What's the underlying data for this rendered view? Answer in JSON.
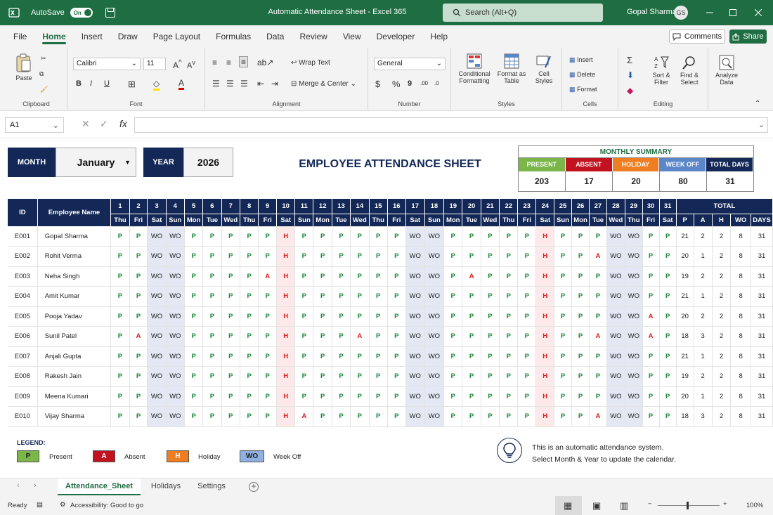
{
  "window": {
    "title": "Automatic Attendance Sheet - Excel 365",
    "autosave_label": "AutoSave",
    "autosave_state": "On",
    "search_placeholder": "Search (Alt+Q)",
    "user_name": "Gopal Sharma",
    "user_initials": "GS"
  },
  "menu": {
    "items": [
      "File",
      "Home",
      "Insert",
      "Draw",
      "Page Layout",
      "Formulas",
      "Data",
      "Review",
      "View",
      "Developer",
      "Help"
    ],
    "active": "Home",
    "comments_label": "Comments",
    "share_label": "Share"
  },
  "ribbon": {
    "clipboard": {
      "paste": "Paste",
      "label": "Clipboard"
    },
    "font": {
      "name": "Calibri",
      "size": "11",
      "label": "Font"
    },
    "alignment": {
      "wrap": "Wrap Text",
      "merge": "Merge & Center",
      "label": "Alignment"
    },
    "number": {
      "format": "General",
      "label": "Number"
    },
    "styles": {
      "cond1": "Conditional",
      "cond2": "Formatting",
      "fmt1": "Format as",
      "fmt2": "Table",
      "cell1": "Cell",
      "cell2": "Styles",
      "label": "Styles"
    },
    "cells": {
      "insert": "Insert",
      "delete": "Delete",
      "format": "Format",
      "label": "Cells"
    },
    "editing": {
      "sort1": "Sort &",
      "sort2": "Filter",
      "find1": "Find &",
      "find2": "Select",
      "label": "Editing"
    },
    "analyze": {
      "l1": "Analyze",
      "l2": "Data"
    }
  },
  "formula_bar": {
    "cell_ref": "A1",
    "fx": "fx",
    "content": ""
  },
  "sheet": {
    "month_label": "MONTH",
    "month_value": "January",
    "year_label": "YEAR",
    "year_value": "2026",
    "title": "EMPLOYEE ATTENDANCE SHEET",
    "summary": {
      "title": "MONTHLY SUMMARY",
      "items": [
        {
          "label": "PRESENT",
          "value": "203",
          "color": "#7ab648"
        },
        {
          "label": "ABSENT",
          "value": "17",
          "color": "#c1121f"
        },
        {
          "label": "HOLIDAY",
          "value": "20",
          "color": "#ef7d22"
        },
        {
          "label": "WEEK OFF",
          "value": "80",
          "color": "#5b87c9"
        },
        {
          "label": "TOTAL DAYS",
          "value": "31",
          "color": "#132856"
        }
      ]
    },
    "table": {
      "id_header": "ID",
      "name_header": "Employee Name",
      "total_header": "TOTAL",
      "days": [
        "1",
        "2",
        "3",
        "4",
        "5",
        "6",
        "7",
        "8",
        "9",
        "10",
        "11",
        "12",
        "13",
        "14",
        "15",
        "16",
        "17",
        "18",
        "19",
        "20",
        "21",
        "22",
        "23",
        "24",
        "25",
        "26",
        "27",
        "28",
        "29",
        "30",
        "31"
      ],
      "weekdays": [
        "Thu",
        "Fri",
        "Sat",
        "Sun",
        "Mon",
        "Tue",
        "Wed",
        "Thu",
        "Fri",
        "Sat",
        "Sun",
        "Mon",
        "Tue",
        "Wed",
        "Thu",
        "Fri",
        "Sat",
        "Sun",
        "Mon",
        "Tue",
        "Wed",
        "Thu",
        "Fri",
        "Sat",
        "Sun",
        "Mon",
        "Tue",
        "Wed",
        "Thu",
        "Fri",
        "Sat"
      ],
      "total_columns": [
        "P",
        "A",
        "H",
        "WO",
        "DAYS"
      ],
      "rows": [
        {
          "id": "E001",
          "name": "Gopal Sharma",
          "marks": [
            "P",
            "P",
            "WO",
            "WO",
            "P",
            "P",
            "P",
            "P",
            "P",
            "H",
            "P",
            "P",
            "P",
            "P",
            "P",
            "P",
            "WO",
            "WO",
            "P",
            "P",
            "P",
            "P",
            "P",
            "H",
            "P",
            "P",
            "P",
            "WO",
            "WO",
            "P",
            "P"
          ],
          "totals": [
            "21",
            "2",
            "2",
            "8",
            "31"
          ]
        },
        {
          "id": "E002",
          "name": "Rohit Verma",
          "marks": [
            "P",
            "P",
            "WO",
            "WO",
            "P",
            "P",
            "P",
            "P",
            "P",
            "H",
            "P",
            "P",
            "P",
            "P",
            "P",
            "P",
            "WO",
            "WO",
            "P",
            "P",
            "P",
            "P",
            "P",
            "H",
            "P",
            "P",
            "A",
            "WO",
            "WO",
            "P",
            "P"
          ],
          "totals": [
            "20",
            "1",
            "2",
            "8",
            "31"
          ]
        },
        {
          "id": "E003",
          "name": "Neha Singh",
          "marks": [
            "P",
            "P",
            "WO",
            "WO",
            "P",
            "P",
            "P",
            "P",
            "A",
            "H",
            "P",
            "P",
            "P",
            "P",
            "P",
            "P",
            "WO",
            "WO",
            "P",
            "A",
            "P",
            "P",
            "P",
            "H",
            "P",
            "P",
            "P",
            "WO",
            "WO",
            "P",
            "P"
          ],
          "totals": [
            "19",
            "2",
            "2",
            "8",
            "31"
          ]
        },
        {
          "id": "E004",
          "name": "Amit Kumar",
          "marks": [
            "P",
            "P",
            "WO",
            "WO",
            "P",
            "P",
            "P",
            "P",
            "P",
            "H",
            "P",
            "P",
            "P",
            "P",
            "P",
            "P",
            "WO",
            "WO",
            "P",
            "P",
            "P",
            "P",
            "P",
            "H",
            "P",
            "P",
            "P",
            "WO",
            "WO",
            "P",
            "P"
          ],
          "totals": [
            "21",
            "1",
            "2",
            "8",
            "31"
          ]
        },
        {
          "id": "E005",
          "name": "Pooja Yadav",
          "marks": [
            "P",
            "P",
            "WO",
            "WO",
            "P",
            "P",
            "P",
            "P",
            "P",
            "H",
            "P",
            "P",
            "P",
            "P",
            "P",
            "P",
            "WO",
            "WO",
            "P",
            "P",
            "P",
            "P",
            "P",
            "H",
            "P",
            "P",
            "P",
            "WO",
            "WO",
            "A",
            "P"
          ],
          "totals": [
            "20",
            "2",
            "2",
            "8",
            "31"
          ]
        },
        {
          "id": "E006",
          "name": "Sunil Patel",
          "marks": [
            "P",
            "A",
            "WO",
            "WO",
            "P",
            "P",
            "P",
            "P",
            "P",
            "H",
            "P",
            "P",
            "P",
            "A",
            "P",
            "P",
            "WO",
            "WO",
            "P",
            "P",
            "P",
            "P",
            "P",
            "H",
            "P",
            "P",
            "A",
            "WO",
            "WO",
            "A",
            "P"
          ],
          "totals": [
            "18",
            "3",
            "2",
            "8",
            "31"
          ]
        },
        {
          "id": "E007",
          "name": "Anjali Gupta",
          "marks": [
            "P",
            "P",
            "WO",
            "WO",
            "P",
            "P",
            "P",
            "P",
            "P",
            "H",
            "P",
            "P",
            "P",
            "P",
            "P",
            "P",
            "WO",
            "WO",
            "P",
            "P",
            "P",
            "P",
            "P",
            "H",
            "P",
            "P",
            "P",
            "WO",
            "WO",
            "P",
            "P"
          ],
          "totals": [
            "21",
            "1",
            "2",
            "8",
            "31"
          ]
        },
        {
          "id": "E008",
          "name": "Rakesh Jain",
          "marks": [
            "P",
            "P",
            "WO",
            "WO",
            "P",
            "P",
            "P",
            "P",
            "P",
            "H",
            "P",
            "P",
            "P",
            "P",
            "P",
            "P",
            "WO",
            "WO",
            "P",
            "P",
            "P",
            "P",
            "P",
            "H",
            "P",
            "P",
            "P",
            "WO",
            "WO",
            "P",
            "P"
          ],
          "totals": [
            "19",
            "2",
            "2",
            "8",
            "31"
          ]
        },
        {
          "id": "E009",
          "name": "Meena Kumari",
          "marks": [
            "P",
            "P",
            "WO",
            "WO",
            "P",
            "P",
            "P",
            "P",
            "P",
            "H",
            "P",
            "P",
            "P",
            "P",
            "P",
            "P",
            "WO",
            "WO",
            "P",
            "P",
            "P",
            "P",
            "P",
            "H",
            "P",
            "P",
            "P",
            "WO",
            "WO",
            "P",
            "P"
          ],
          "totals": [
            "20",
            "1",
            "2",
            "8",
            "31"
          ]
        },
        {
          "id": "E010",
          "name": "Vijay Sharma",
          "marks": [
            "P",
            "P",
            "WO",
            "WO",
            "P",
            "P",
            "P",
            "P",
            "P",
            "H",
            "A",
            "P",
            "P",
            "P",
            "P",
            "P",
            "WO",
            "WO",
            "P",
            "P",
            "P",
            "P",
            "P",
            "H",
            "P",
            "P",
            "A",
            "WO",
            "WO",
            "P",
            "P"
          ],
          "totals": [
            "18",
            "3",
            "2",
            "8",
            "31"
          ]
        }
      ]
    },
    "legend": {
      "title": "LEGEND:",
      "items": [
        {
          "code": "P",
          "label": "Present",
          "color": "#7ab648"
        },
        {
          "code": "A",
          "label": "Absent",
          "color": "#c1121f"
        },
        {
          "code": "H",
          "label": "Holiday",
          "color": "#ef7d22"
        },
        {
          "code": "WO",
          "label": "Week Off",
          "color": "#8fb0e0"
        }
      ]
    },
    "note": {
      "line1": "This is an automatic attendance system.",
      "line2": "Select Month & Year to update the calendar."
    }
  },
  "tabs": {
    "items": [
      "Attendance_Sheet",
      "Holidays",
      "Settings"
    ],
    "active": "Attendance_Sheet"
  },
  "status": {
    "ready": "Ready",
    "accessibility": "Accessibility: Good to go",
    "zoom": "100%"
  }
}
